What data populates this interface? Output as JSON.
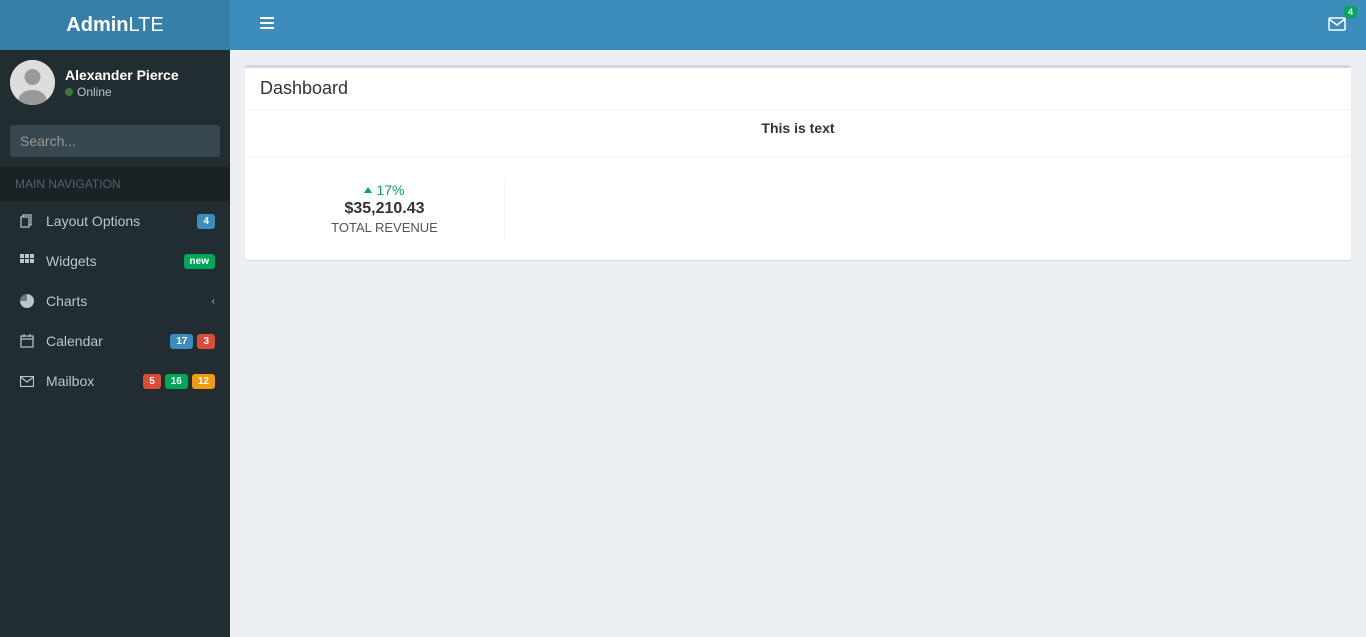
{
  "brand": {
    "bold": "Admin",
    "light": "LTE"
  },
  "header": {
    "messages_badge": "4"
  },
  "user": {
    "name": "Alexander Pierce",
    "status": "Online"
  },
  "search": {
    "placeholder": "Search..."
  },
  "nav_header": "MAIN NAVIGATION",
  "menu": {
    "layout": {
      "label": "Layout Options",
      "badge": "4"
    },
    "widgets": {
      "label": "Widgets",
      "badge": "new"
    },
    "charts": {
      "label": "Charts"
    },
    "calendar": {
      "label": "Calendar",
      "badge1": "17",
      "badge2": "3"
    },
    "mailbox": {
      "label": "Mailbox",
      "badge1": "5",
      "badge2": "16",
      "badge3": "12"
    }
  },
  "page": {
    "title": "Dashboard",
    "subtitle": "This is text"
  },
  "stat": {
    "percent": "17%",
    "value": "$35,210.43",
    "label": "TOTAL REVENUE"
  }
}
